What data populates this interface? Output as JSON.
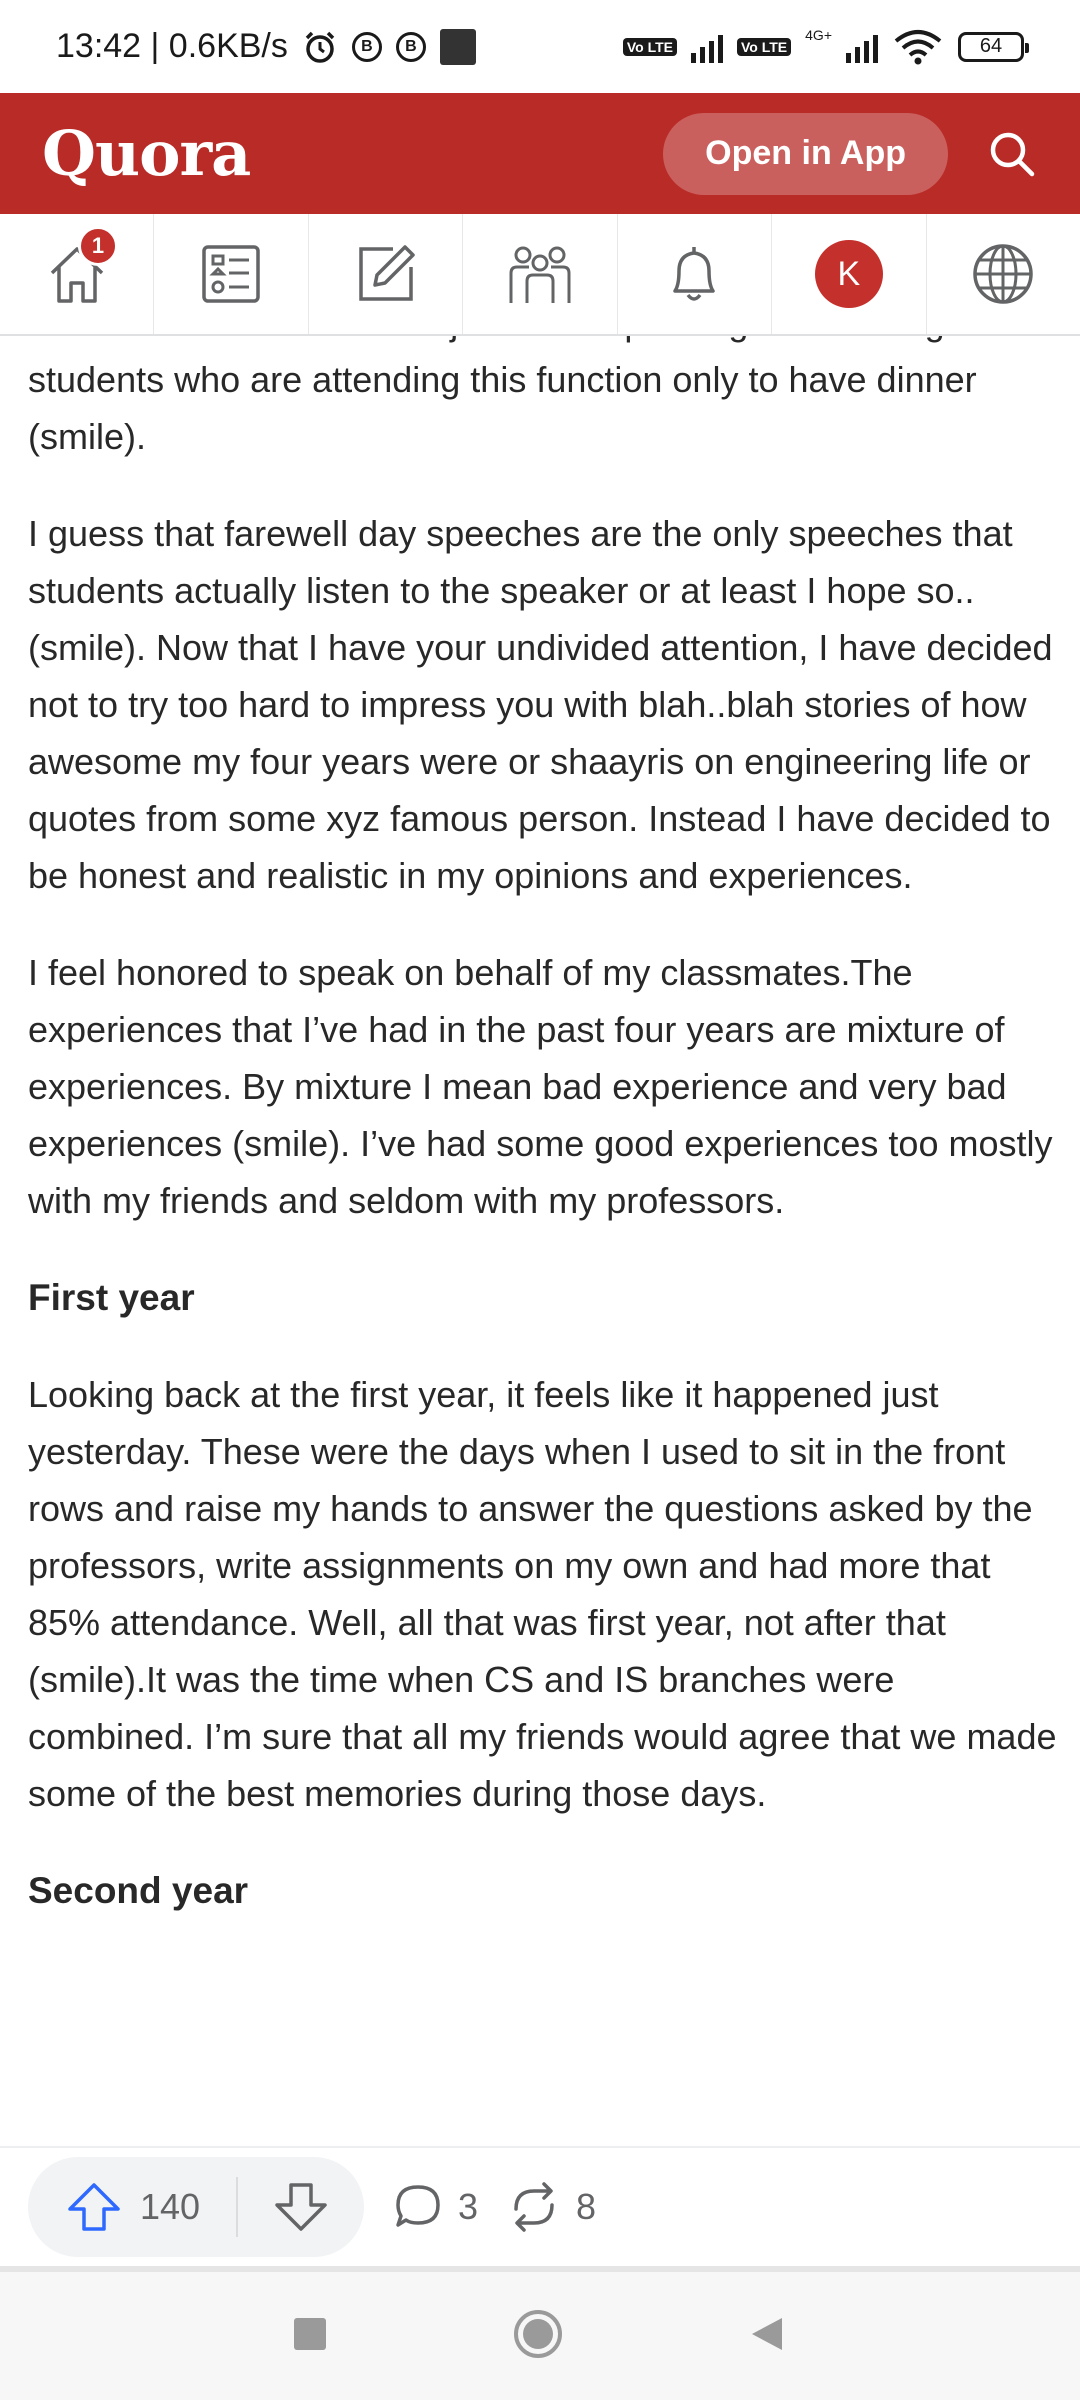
{
  "status_bar": {
    "time_speed": "13:42 | 0.6KB/s",
    "volte1": "Vo LTE",
    "volte2": "Vo LTE",
    "network": "4G+",
    "battery": "64"
  },
  "header": {
    "logo": "Quora",
    "open_in_app": "Open in App"
  },
  "nav": {
    "home_badge": "1",
    "avatar_initial": "K"
  },
  "content": {
    "partial_top": "fellow students and sweet juniors. A special good evening to the students who are attending this function only to have dinner (smile).",
    "para2": "I guess that farewell day speeches are the only speeches that students actually listen to the speaker or at least I hope so..(smile). Now that I have your undivided attention, I have decided not to try too hard to impress you with blah..blah stories of how awesome my four years were or shaayris on engineering life or quotes from some xyz famous person. Instead I have decided to be honest and realistic in my opinions and experiences.",
    "para3": "I feel honored to speak on behalf of my classmates.The experiences that I’ve had in the past four years are mixture of experiences. By mixture I mean bad experience and very bad experiences (smile). I’ve had some good experiences too mostly with my friends and seldom with my professors.",
    "heading_first_year": "First year",
    "para4": "Looking back at the first year, it feels like it happened just yesterday. These were the days when I used to sit in the front rows and raise my hands to answer the questions asked by the professors, write assignments on my own and had more that 85% attendance. Well, all that was first year, not after that (smile).It was the time when CS and IS branches were combined. I’m sure that all my friends would agree that we made some of the best memories during those days.",
    "heading_second_year": "Second year"
  },
  "actions": {
    "upvotes": "140",
    "comments": "3",
    "shares": "8"
  },
  "colors": {
    "brand": "#b92b27",
    "text": "#282829"
  }
}
